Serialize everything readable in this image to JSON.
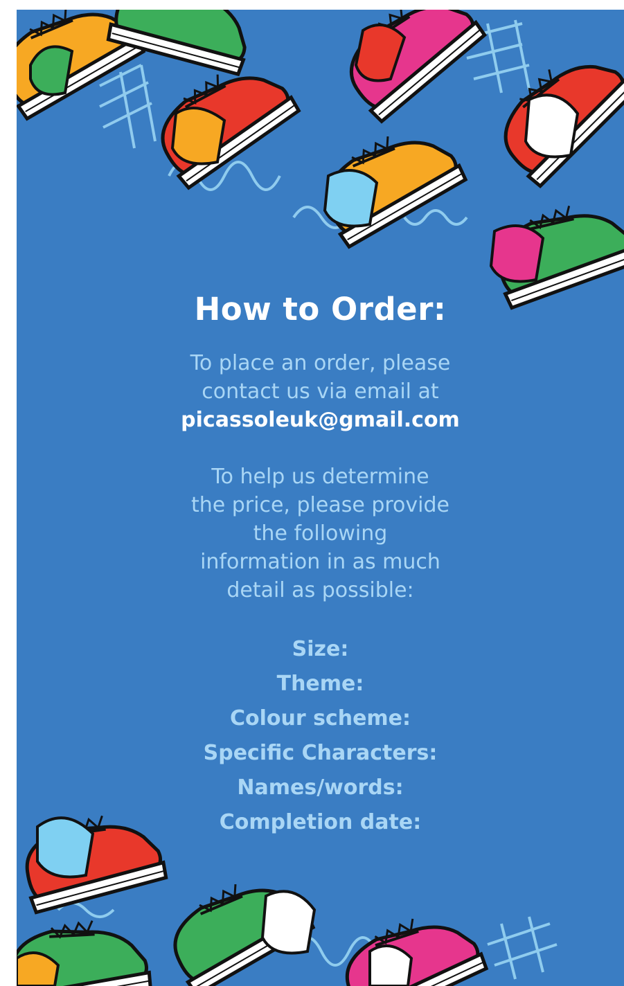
{
  "title": "How to Order:",
  "intro_lines": [
    "To place an order, please",
    "contact us via email at"
  ],
  "email": "picassoleuk@gmail.com",
  "help_lines": [
    "To help us determine",
    "the price, please provide",
    "the following",
    "information in as much",
    "detail as possible:"
  ],
  "fields": [
    "Size:",
    "Theme:",
    "Colour scheme:",
    "Specific Characters:",
    "Names/words:",
    "Completion date:"
  ],
  "colors": {
    "background": "#3a7dc3",
    "title": "#ffffff",
    "body_text": "#a9d6f5",
    "sneaker_orange": "#f7a823",
    "sneaker_red": "#e8382b",
    "sneaker_green": "#3cae5a",
    "sneaker_pink": "#e6368d",
    "sneaker_lightblue": "#7fd0f2"
  }
}
